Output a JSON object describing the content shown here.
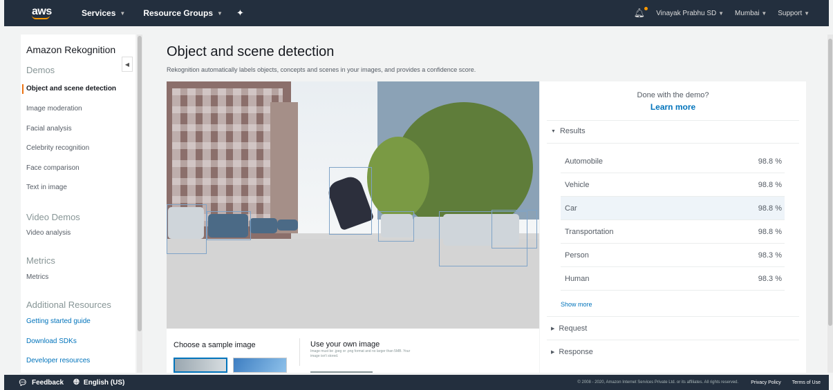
{
  "topnav": {
    "logo_text": "aws",
    "services": "Services",
    "resource_groups": "Resource Groups",
    "account": "Vinayak Prabhu SD",
    "region": "Mumbai",
    "support": "Support"
  },
  "sidebar": {
    "title": "Amazon Rekognition",
    "demos_heading": "Demos",
    "demos": [
      "Object and scene detection",
      "Image moderation",
      "Facial analysis",
      "Celebrity recognition",
      "Face comparison",
      "Text in image"
    ],
    "video_heading": "Video Demos",
    "video": [
      "Video analysis"
    ],
    "metrics_heading": "Metrics",
    "metrics": [
      "Metrics"
    ],
    "additional_heading": "Additional Resources",
    "additional": [
      "Getting started guide",
      "Download SDKs",
      "Developer resources"
    ]
  },
  "main": {
    "title": "Object and scene detection",
    "description": "Rekognition automatically labels objects, concepts and scenes in your images, and provides a confidence score.",
    "sample_label": "Choose a sample image",
    "own_label": "Use your own image",
    "own_desc": "Image must be .jpeg or .png format and no larger than 5MB. Your image isn't stored."
  },
  "results": {
    "done_text": "Done with the demo?",
    "learn_more": "Learn more",
    "results_heading": "Results",
    "labels": [
      {
        "name": "Automobile",
        "confidence": "98.8 %"
      },
      {
        "name": "Vehicle",
        "confidence": "98.8 %"
      },
      {
        "name": "Car",
        "confidence": "98.8 %"
      },
      {
        "name": "Transportation",
        "confidence": "98.8 %"
      },
      {
        "name": "Person",
        "confidence": "98.3 %"
      },
      {
        "name": "Human",
        "confidence": "98.3 %"
      }
    ],
    "show_more": "Show more",
    "request_heading": "Request",
    "response_heading": "Response"
  },
  "footer": {
    "feedback": "Feedback",
    "language": "English (US)",
    "copyright": "© 2008 - 2020, Amazon Internet Services Private Ltd. or its affiliates. All rights reserved.",
    "privacy": "Privacy Policy",
    "terms": "Terms of Use"
  },
  "colors": {
    "nav_bg": "#232f3e",
    "accent_orange": "#ec7211",
    "link_blue": "#0073bb"
  }
}
